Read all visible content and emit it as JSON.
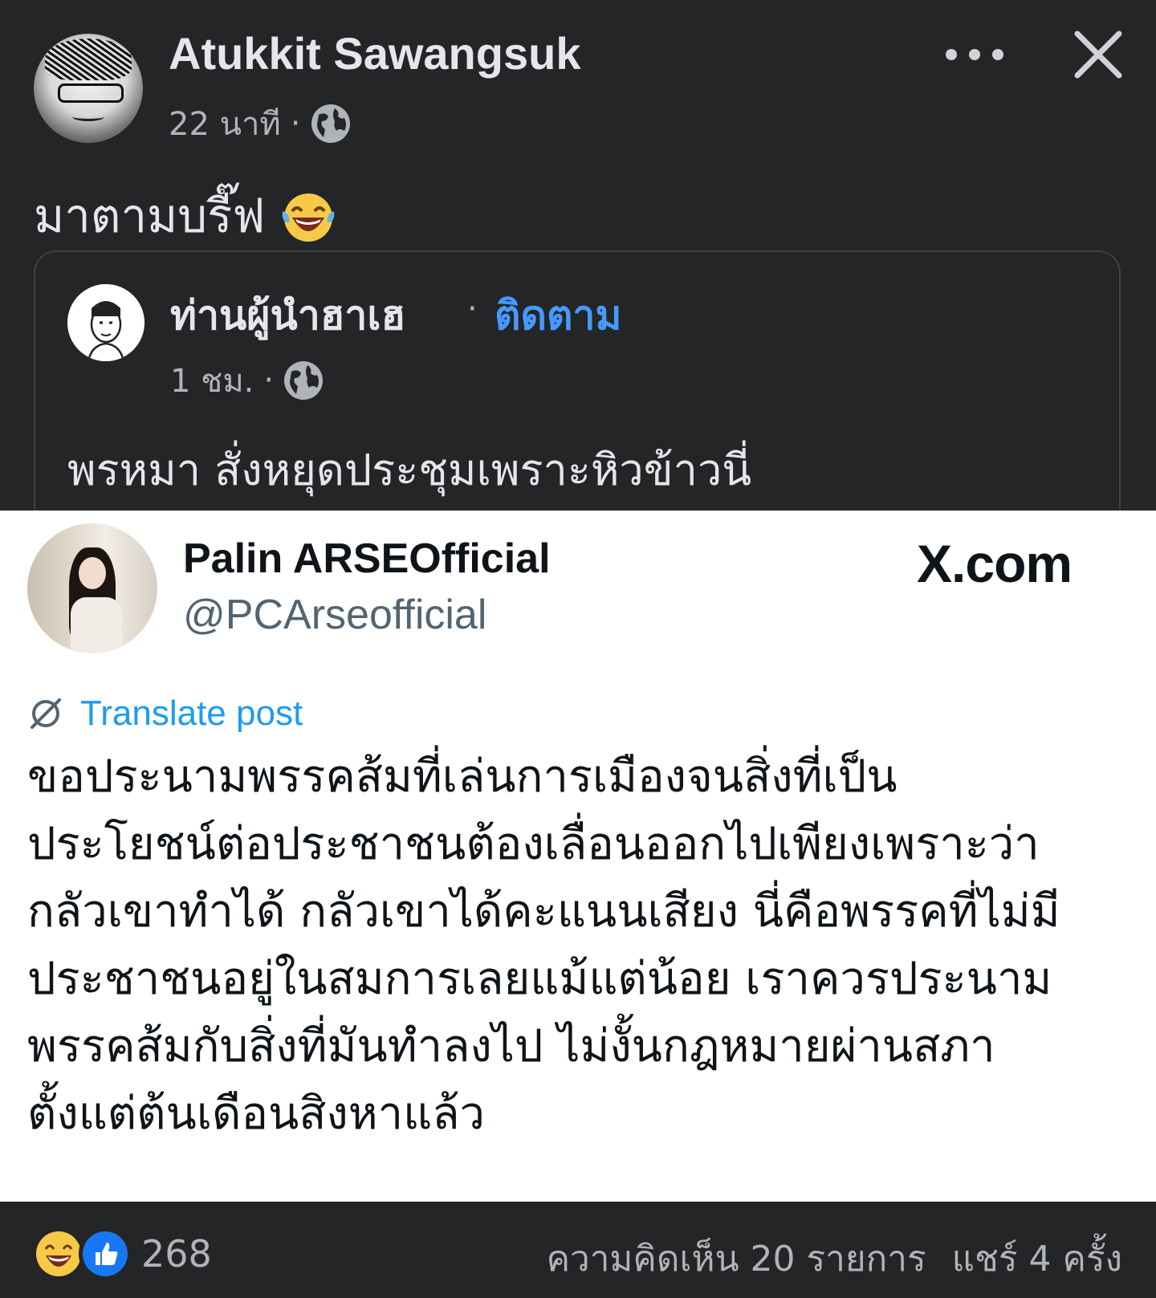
{
  "post": {
    "author_name": "Atukkit Sawangsuk",
    "time": "22 นาที",
    "separator": "·",
    "privacy_icon": "globe-icon",
    "text": "มาตามบรี๊ฟ",
    "emoji": "face-with-tears-of-joy"
  },
  "shared": {
    "page_name": "ท่านผู้นำฮาเฮ",
    "separator": "·",
    "follow_label": "ติดตาม",
    "time": "1 ชม.",
    "privacy_icon": "globe-icon",
    "text": "พรหมา สั่งหยุดประชุมเพราะหิวข้าวนี่"
  },
  "embed": {
    "display_name": "Palin ARSEOfficial",
    "handle": "@PCArseofficial",
    "site": "X.com",
    "translate_label": "Translate post",
    "body_lines": [
      "ขอประนามพรรคส้มที่เล่นการเมืองจนสิ่งที่เป็น",
      "ประโยชน์ต่อประชาชนต้องเลื่อนออกไปเพียงเพราะว่า",
      "กลัวเขาทำได้ กลัวเขาได้คะแนนเสียง นี่คือพรรคที่ไม่มี",
      "ประชาชนอยู่ในสมการเลยแม้แต่น้อย เราควรประนาม",
      "พรรคส้มกับสิ่งที่มันทำลงไป ไม่งั้นกฎหมายผ่านสภา",
      "ตั้งแต่ต้นเดือนสิงหาแล้ว"
    ]
  },
  "footer": {
    "reaction_count": "268",
    "comments": "ความคิดเห็น 20 รายการ",
    "shares": "แชร์ 4 ครั้ง"
  },
  "colors": {
    "background": "#242526",
    "text_primary": "#e4e6eb",
    "text_secondary": "#b0b3b8",
    "link_blue": "#4599ff",
    "twitter_blue": "#1d9bf0"
  }
}
